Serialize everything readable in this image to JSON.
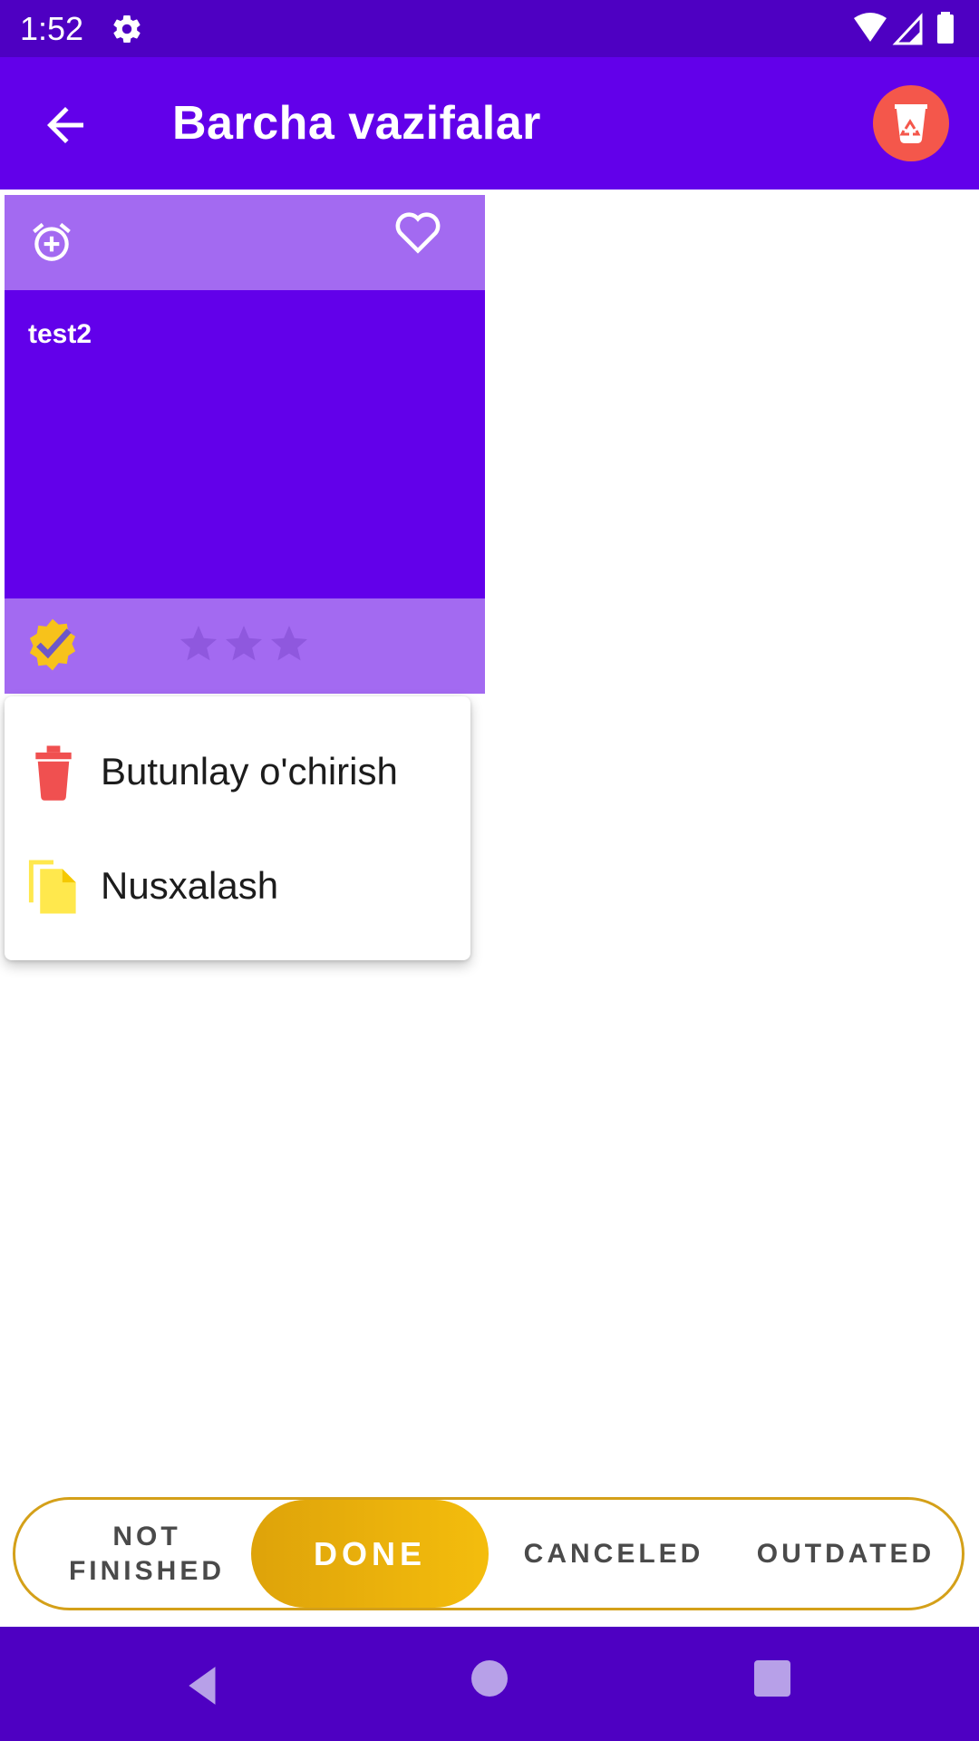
{
  "status_bar": {
    "time": "1:52",
    "icons": [
      "gear-icon",
      "wifi-icon",
      "signal-icon",
      "battery-icon"
    ]
  },
  "app_bar": {
    "title": "Barcha vazifalar",
    "back_icon": "arrow-left-icon",
    "trash_icon": "recycle-bin-icon"
  },
  "task_card": {
    "text": "test2",
    "top_icons": [
      "alarm-add-icon",
      "heart-outline-icon"
    ],
    "status_icon": "verified-badge-icon",
    "stars": 3,
    "colors": {
      "header": "#a36af1",
      "body": "#6200ea"
    }
  },
  "context_menu": {
    "items": [
      {
        "label": "Butunlay o'chirish",
        "icon": "trash-can-icon"
      },
      {
        "label": "Nusxalash",
        "icon": "copy-icon"
      }
    ]
  },
  "filter_tabs": {
    "tabs": [
      {
        "label": "NOT FINISHED",
        "line1": "NOT",
        "line2": "FINISHED"
      },
      {
        "label": "DONE"
      },
      {
        "label": "CANCELED"
      },
      {
        "label": "OUTDATED"
      }
    ],
    "selected": "DONE",
    "accent": "#e8ad0b"
  },
  "nav_bar": {
    "icons": [
      "nav-back-icon",
      "nav-home-icon",
      "nav-recents-icon"
    ]
  },
  "colors": {
    "status_bar": "#4e00c2",
    "app_bar": "#6200ea",
    "trash_button": "#f4574b",
    "menu_delete": "#f05050",
    "menu_copy": "#ffe84d"
  }
}
